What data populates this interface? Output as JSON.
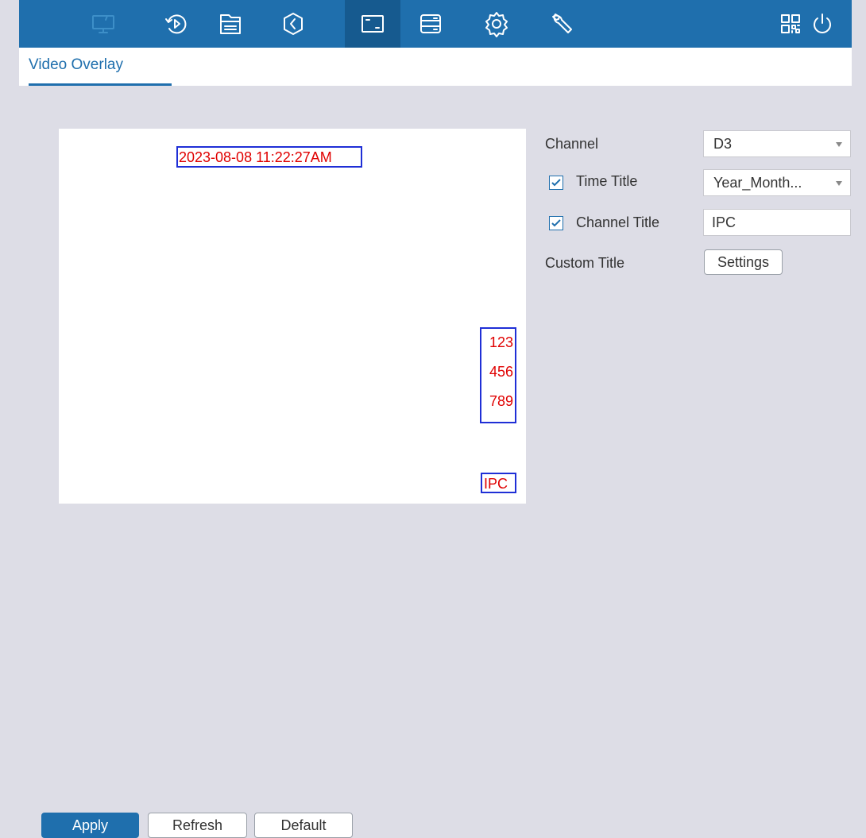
{
  "nav": {
    "icons": [
      "monitor-icon",
      "playback-icon",
      "file-icon",
      "history-icon",
      "display-icon",
      "storage-icon",
      "settings-gear-icon",
      "maintenance-wrench-icon"
    ],
    "right_icons": [
      "qr-code-icon",
      "power-icon"
    ]
  },
  "tab": {
    "label": "Video Overlay"
  },
  "preview": {
    "time_overlay": "2023-08-08 11:22:27AM",
    "custom_lines": [
      "123",
      "456",
      "789"
    ],
    "channel_overlay": "IPC"
  },
  "form": {
    "channel_label": "Channel",
    "channel_value": "D3",
    "time_title_label": "Time Title",
    "time_title_checked": true,
    "time_title_value": "Year_Month...",
    "channel_title_label": "Channel Title",
    "channel_title_checked": true,
    "channel_title_value": "IPC",
    "custom_title_label": "Custom Title",
    "settings_button": "Settings"
  },
  "footer": {
    "apply": "Apply",
    "refresh": "Refresh",
    "default": "Default"
  },
  "colors": {
    "accent": "#1f6fad",
    "overlay_text": "#e00000",
    "overlay_box": "#1f2fd6",
    "background": "#dddde6"
  }
}
